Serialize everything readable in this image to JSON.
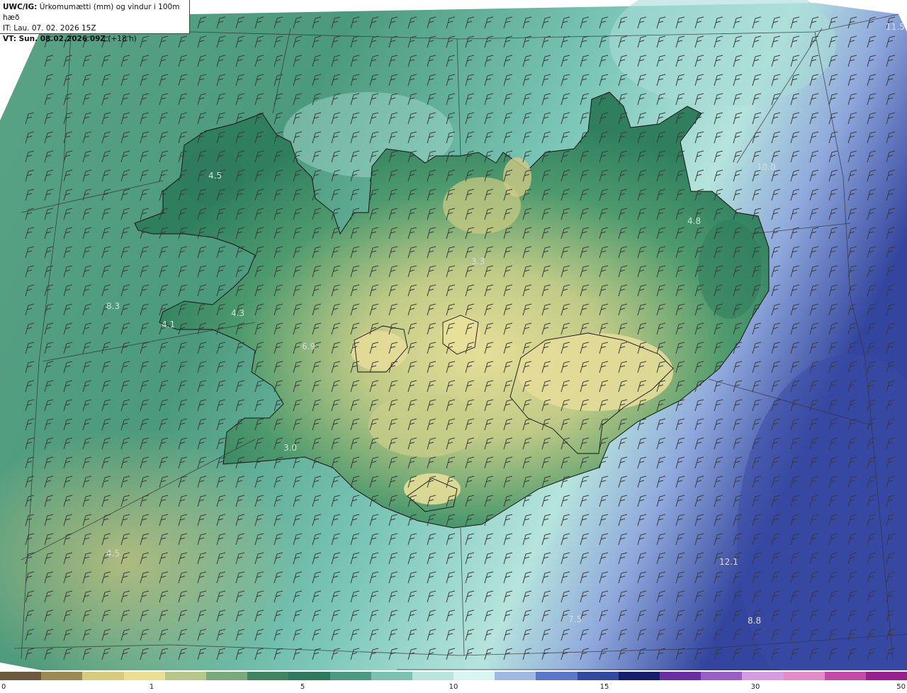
{
  "header": {
    "model": "UWC/IG:",
    "product": " Úrkomumætti (mm) og vindur i 100m hæð",
    "init_time": "IT: Lau. 07. 02. 2026 15Z",
    "valid_prefix": "VT: ",
    "valid_time": "Sun. 08.02.2026 09Z",
    "lead": " (+18 h)"
  },
  "map_values": [
    "11.5",
    "4.5",
    "10.0",
    "4.8",
    "3.3",
    "8.3",
    "4.3",
    "4.1",
    "6.9",
    "3.0",
    "4.5",
    "12.1",
    "7.5",
    "8.8"
  ],
  "colorbar": {
    "ticks": [
      "0",
      "1",
      "5",
      "10",
      "15",
      "30",
      "50"
    ],
    "colors": [
      "#6b5a3e",
      "#9c8a55",
      "#d7cc7e",
      "#eadf92",
      "#b7c78a",
      "#7aaa7c",
      "#3f8560",
      "#2f7a5f",
      "#4a9b82",
      "#7cc2b2",
      "#b8e6df",
      "#d9f4f2",
      "#9fb9e2",
      "#5b78c8",
      "#33489f",
      "#171d6d",
      "#6a2ea0",
      "#9a5fc5",
      "#d79bdf",
      "#e48cc7",
      "#c44aa8",
      "#98208f"
    ]
  },
  "colors": {
    "land_dry": "#e3dc95",
    "land_mid": "#3f8f68",
    "sea": "#7fc8bb",
    "sea_wet": "#5468b8",
    "coast": "#111111",
    "grid": "#333333",
    "barb": "#3a3a3a"
  }
}
